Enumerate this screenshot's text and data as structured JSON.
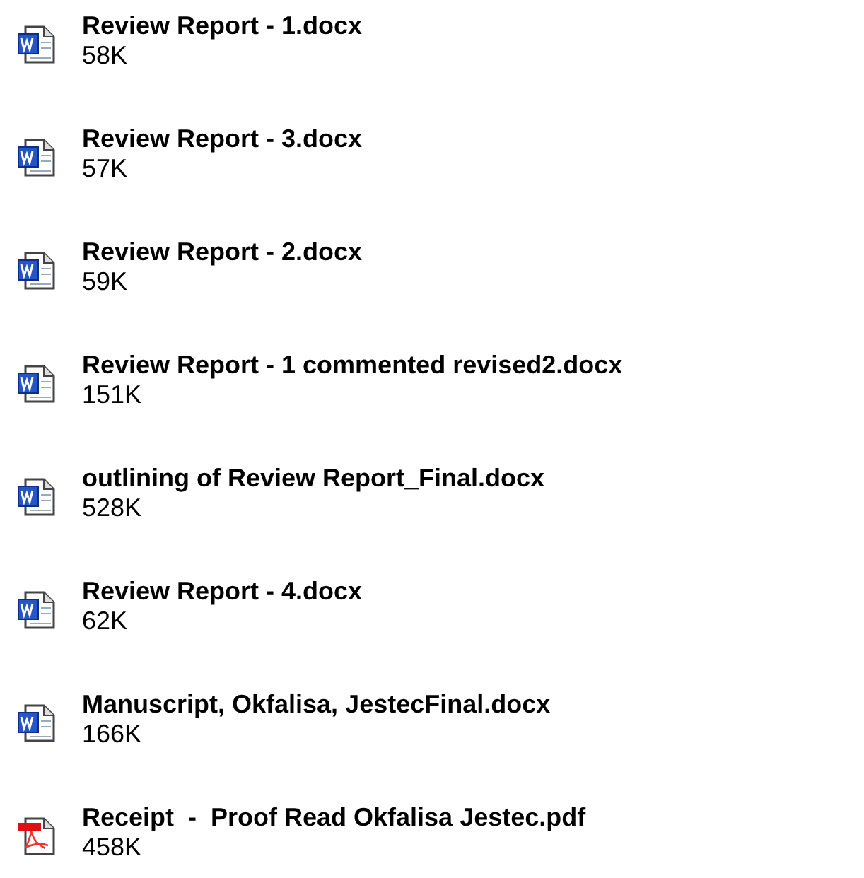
{
  "files": [
    {
      "kind": "word",
      "name": "Review Report - 1.docx",
      "size": "58K"
    },
    {
      "kind": "word",
      "name": "Review Report - 3.docx",
      "size": "57K"
    },
    {
      "kind": "word",
      "name": "Review Report - 2.docx",
      "size": "59K"
    },
    {
      "kind": "word",
      "name": "Review Report - 1 commented revised2.docx",
      "size": "151K"
    },
    {
      "kind": "word",
      "name": "outlining of Review Report_Final.docx",
      "size": "528K"
    },
    {
      "kind": "word",
      "name": "Review Report - 4.docx",
      "size": "62K"
    },
    {
      "kind": "word",
      "name": "Manuscript, Okfalisa, JestecFinal.docx",
      "size": "166K"
    },
    {
      "kind": "pdf",
      "name": "Receipt  -  Proof Read Okfalisa Jestec.pdf",
      "size": "458K"
    }
  ]
}
